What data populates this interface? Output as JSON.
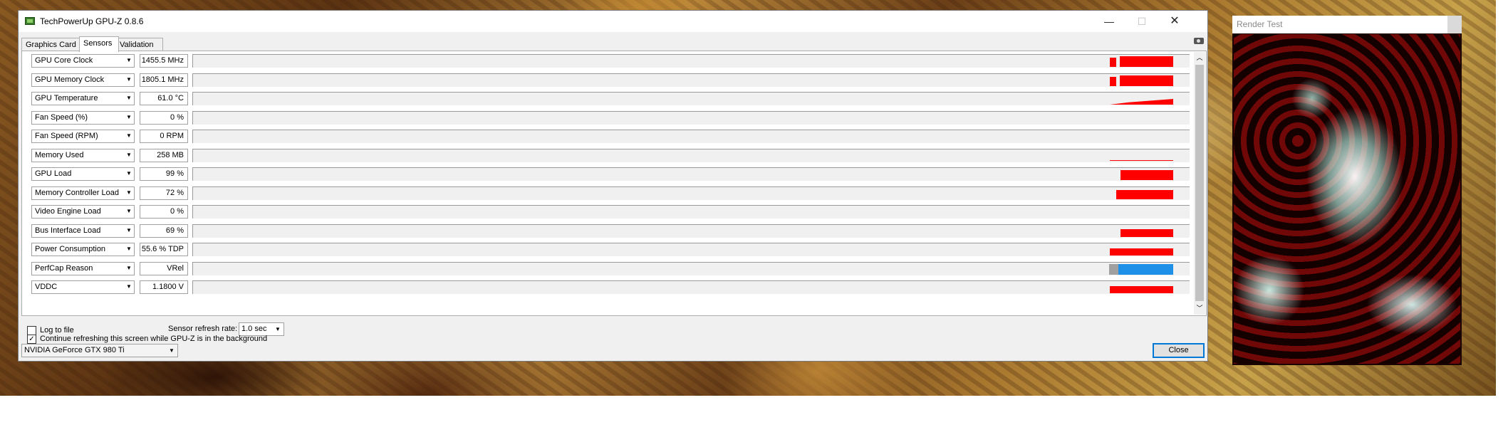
{
  "window": {
    "title": "TechPowerUp GPU-Z 0.8.6",
    "controls": {
      "minimize": "—",
      "maximize": "☐",
      "close": "✕"
    }
  },
  "tabs": [
    {
      "label": "Graphics Card",
      "active": false
    },
    {
      "label": "Sensors",
      "active": true
    },
    {
      "label": "Validation",
      "active": false
    }
  ],
  "sensors": [
    {
      "name": "GPU Core Clock",
      "value": "1455.5 MHz"
    },
    {
      "name": "GPU Memory Clock",
      "value": "1805.1 MHz"
    },
    {
      "name": "GPU Temperature",
      "value": "61.0 °C"
    },
    {
      "name": "Fan Speed (%)",
      "value": "0 %"
    },
    {
      "name": "Fan Speed (RPM)",
      "value": "0 RPM"
    },
    {
      "name": "Memory Used",
      "value": "258 MB"
    },
    {
      "name": "GPU Load",
      "value": "99 %"
    },
    {
      "name": "Memory Controller Load",
      "value": "72 %"
    },
    {
      "name": "Video Engine Load",
      "value": "0 %"
    },
    {
      "name": "Bus Interface Load",
      "value": "69 %"
    },
    {
      "name": "Power Consumption",
      "value": "55.6 % TDP"
    },
    {
      "name": "PerfCap Reason",
      "value": "VRel"
    },
    {
      "name": "VDDC",
      "value": "1.1800 V"
    }
  ],
  "options": {
    "log_to_file": {
      "label": "Log to file",
      "checked": false
    },
    "continue_refreshing": {
      "label": "Continue refreshing this screen while GPU-Z is in the background",
      "checked": true
    },
    "refresh_rate_label": "Sensor refresh rate:",
    "refresh_rate_value": "1.0 sec"
  },
  "device": {
    "selected": "NVIDIA GeForce GTX 980 Ti"
  },
  "close_label": "Close",
  "render_window": {
    "title": "Render Test"
  },
  "colors": {
    "graph_red": "#ff0000",
    "perfcap_vrel": "#1e90e8",
    "perfcap_gray": "#a0a0a0",
    "accent": "#0078d7"
  },
  "icons": {
    "dropdown": "▼",
    "scroll_up": "︿",
    "scroll_down": "﹀",
    "checked": "✓"
  }
}
